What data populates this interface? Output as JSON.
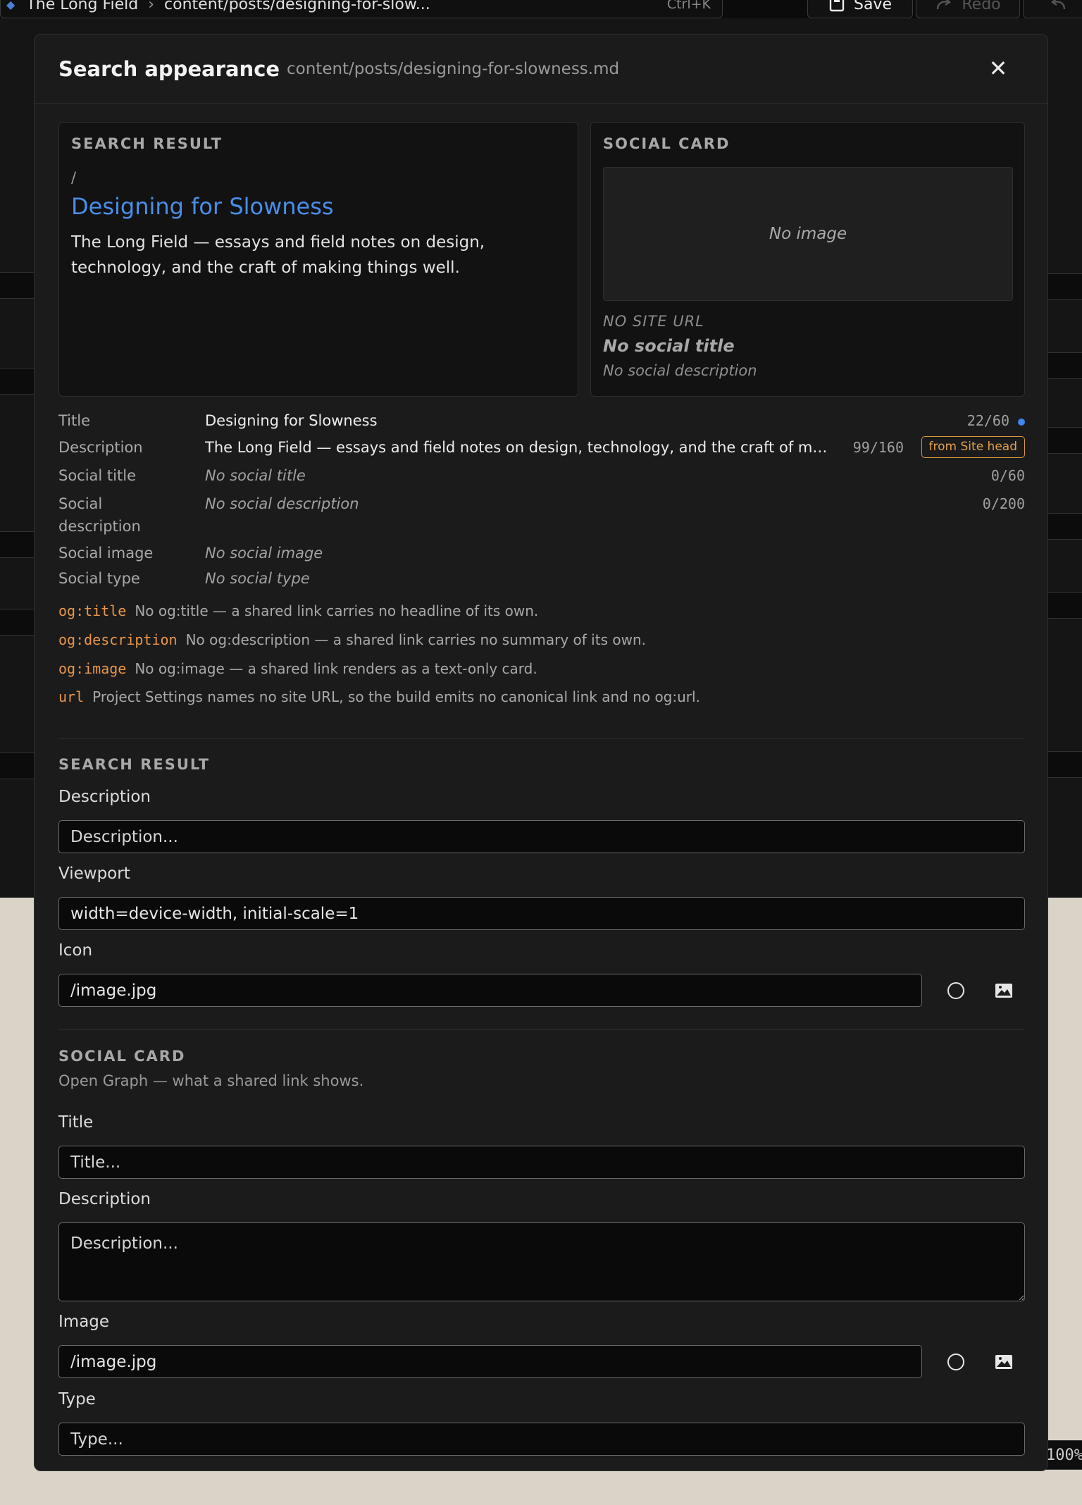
{
  "topbar": {
    "site_name": "The Long Field",
    "breadcrumb_sep": "›",
    "file_path": "content/posts/designing-for-slow...",
    "shortcut": "Ctrl+K",
    "save_label": "Save",
    "redo_label": "Redo"
  },
  "modal": {
    "title": "Search appearance",
    "path": "content/posts/designing-for-slowness.md",
    "close_glyph": "✕",
    "search_preview": {
      "label": "SEARCH RESULT",
      "crumb": "/",
      "title": "Designing for Slowness",
      "description": "The Long Field — essays and field notes on design, technology, and the craft of making things well."
    },
    "social_preview": {
      "label": "SOCIAL CARD",
      "image_placeholder": "No image",
      "site_url": "NO SITE URL",
      "title": "No social title",
      "description": "No social description"
    },
    "meta": {
      "title": {
        "key": "Title",
        "value": "Designing for Slowness",
        "count": "22/60"
      },
      "description": {
        "key": "Description",
        "value": "The Long Field — essays and field notes on design, technology, and the craft of making things well.",
        "count": "99/160",
        "badge": "from Site head"
      },
      "social_title": {
        "key": "Social title",
        "value": "No social title",
        "count": "0/60"
      },
      "social_description": {
        "key": "Social description",
        "value": "No social description",
        "count": "0/200"
      },
      "social_image": {
        "key": "Social image",
        "value": "No social image"
      },
      "social_type": {
        "key": "Social type",
        "value": "No social type"
      }
    },
    "warnings": [
      {
        "code": "og:title",
        "text": "No og:title — a shared link carries no headline of its own."
      },
      {
        "code": "og:description",
        "text": "No og:description — a shared link carries no summary of its own."
      },
      {
        "code": "og:image",
        "text": "No og:image — a shared link renders as a text-only card."
      },
      {
        "code": "url",
        "text": "Project Settings names no site URL, so the build emits no canonical link and no og:url."
      }
    ],
    "search_section": {
      "heading": "SEARCH RESULT",
      "description_label": "Description",
      "description_placeholder": "Description...",
      "viewport_label": "Viewport",
      "viewport_value": "width=device-width, initial-scale=1",
      "icon_label": "Icon",
      "icon_value": "/image.jpg"
    },
    "social_section": {
      "heading": "SOCIAL CARD",
      "subheading": "Open Graph — what a shared link shows.",
      "title_label": "Title",
      "title_placeholder": "Title...",
      "description_label": "Description",
      "description_placeholder": "Description...",
      "image_label": "Image",
      "image_value": "/image.jpg",
      "type_label": "Type",
      "type_placeholder": "Type..."
    }
  },
  "zoom": "100%",
  "colors": {
    "accent": "#4a8ee8",
    "warning": "#e8964a",
    "badge": "#e0a04a"
  }
}
